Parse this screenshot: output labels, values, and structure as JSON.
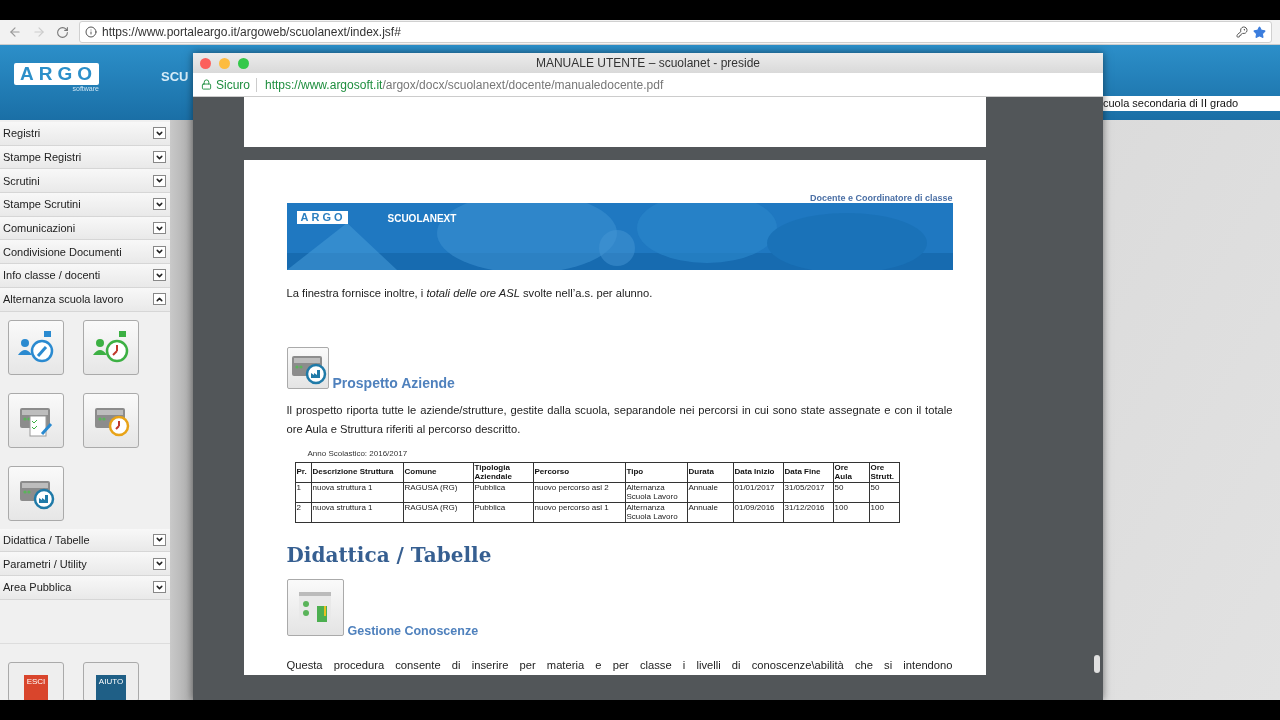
{
  "browser": {
    "url": "https://www.portaleargo.it/argoweb/scuolanext/index.jsf#"
  },
  "app": {
    "logo": "ARGO",
    "logo_sub": "software",
    "header_text": "SCU",
    "school_field": "cuola secondaria di II grado"
  },
  "sidebar": {
    "sections": [
      {
        "label": "Registri",
        "expanded": false
      },
      {
        "label": "Stampe Registri",
        "expanded": false
      },
      {
        "label": "Scrutini",
        "expanded": false
      },
      {
        "label": "Stampe Scrutini",
        "expanded": false
      },
      {
        "label": "Comunicazioni",
        "expanded": false
      },
      {
        "label": "Condivisione Documenti",
        "expanded": false
      },
      {
        "label": "Info classe / docenti",
        "expanded": false
      },
      {
        "label": "Alternanza scuola lavoro",
        "expanded": true,
        "tiles": [
          {
            "kind": "person-edit"
          },
          {
            "kind": "person-clock"
          },
          {
            "kind": "printer-check"
          },
          {
            "kind": "printer-clock"
          },
          {
            "kind": "printer-factory"
          }
        ]
      },
      {
        "label": "Didattica / Tabelle",
        "expanded": false
      },
      {
        "label": "Parametri / Utility",
        "expanded": false
      },
      {
        "label": "Area Pubblica",
        "expanded": false
      }
    ],
    "footer_buttons": [
      {
        "label": "ESCI",
        "color": "#d9452c"
      },
      {
        "label": "AIUTO",
        "color": "#1f5f86"
      }
    ]
  },
  "popup": {
    "title": "MANUALE UTENTE – scuolanet - preside",
    "secure_label": "Sicuro",
    "url_origin": "https://www.argosoft.it",
    "url_path": "/argox/docx/scuolanext/docente/manualedocente.pdf",
    "document": {
      "header_note": "Docente e Coordinatore di classe",
      "banner": {
        "logo": "ARGO",
        "product": "SCUOLANEXT"
      },
      "blocks": [
        {
          "kind": "paragraph",
          "text": "La finestra fornisce inoltre, i *totali delle ore ASL* svolte nell’a.s. per alunno."
        },
        {
          "kind": "section",
          "title": "Prospetto Aziende"
        },
        {
          "kind": "paragraph",
          "text": "Il prospetto riporta tutte le aziende/strutture, gestite dalla scuola, separandole nei percorsi in cui sono state assegnate e con il totale ore Aula e Struttura riferiti al percorso descritto."
        },
        {
          "kind": "table",
          "caption": "Anno Scolastico: 2016/2017",
          "columns": [
            "Pr.",
            "Descrizione Struttura",
            "Comune",
            "Tipologia Aziendale",
            "Percorso",
            "Tipo",
            "Durata",
            "Data Inizio",
            "Data Fine",
            "Ore Aula",
            "Ore Strutt."
          ],
          "rows": [
            [
              "1",
              "nuova struttura 1",
              "RAGUSA (RG)",
              "Pubblica",
              "nuovo percorso asl 2",
              "Alternanza Scuola Lavoro",
              "Annuale",
              "01/01/2017",
              "31/05/2017",
              "50",
              "50"
            ],
            [
              "2",
              "nuova struttura 1",
              "RAGUSA (RG)",
              "Pubblica",
              "nuovo percorso asl 1",
              "Alternanza Scuola Lavoro",
              "Annuale",
              "01/09/2016",
              "31/12/2016",
              "100",
              "100"
            ]
          ]
        },
        {
          "kind": "heading",
          "text": "Didattica / Tabelle"
        },
        {
          "kind": "section",
          "title": "Gestione Conoscenze"
        },
        {
          "kind": "paragraph",
          "text": "Questa procedura consente di inserire per materia e per classe i livelli di conoscenze\\abilità che si intendono"
        }
      ]
    }
  }
}
